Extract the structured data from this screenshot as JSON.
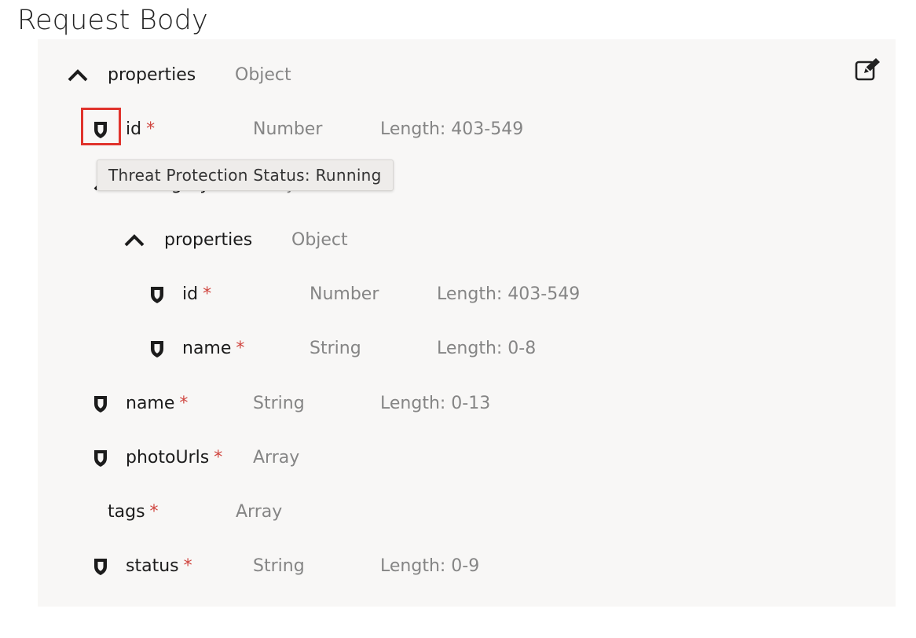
{
  "page": {
    "title": "Request Body"
  },
  "tooltip": {
    "text": "Threat Protection Status: Running"
  },
  "schema": {
    "root": {
      "name": "properties",
      "type": "Object"
    },
    "id": {
      "name": "id",
      "required_mark": "*",
      "type": "Number",
      "length": "Length: 403-549"
    },
    "category": {
      "name": "category",
      "required_mark": "*",
      "type": "Object"
    },
    "category_properties": {
      "name": "properties",
      "type": "Object"
    },
    "category_id": {
      "name": "id",
      "required_mark": "*",
      "type": "Number",
      "length": "Length: 403-549"
    },
    "category_name": {
      "name": "name",
      "required_mark": "*",
      "type": "String",
      "length": "Length: 0-8"
    },
    "name": {
      "name": "name",
      "required_mark": "*",
      "type": "String",
      "length": "Length: 0-13"
    },
    "photoUrls": {
      "name": "photoUrls",
      "required_mark": "*",
      "type": "Array"
    },
    "tags": {
      "name": "tags",
      "required_mark": "*",
      "type": "Array"
    },
    "status": {
      "name": "status",
      "required_mark": "*",
      "type": "String",
      "length": "Length: 0-9"
    }
  },
  "icons": {
    "expand": "chevron-up-icon",
    "protection": "shield-icon",
    "edit": "edit-icon"
  },
  "colors": {
    "required": "#d0453f",
    "highlight": "#e0332c",
    "panel": "#f8f7f6",
    "muted": "#858585"
  }
}
